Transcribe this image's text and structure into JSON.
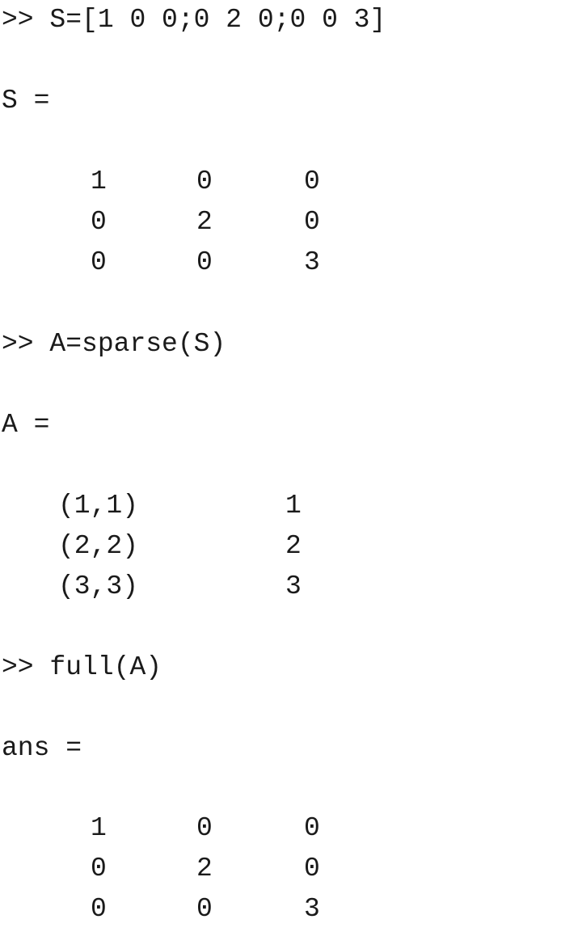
{
  "commands": [
    {
      "prompt": ">>",
      "input": "S=[1 0 0;0 2 0;0 0 3]",
      "output_var": "S =",
      "matrix": [
        [
          "1",
          "0",
          "0"
        ],
        [
          "0",
          "2",
          "0"
        ],
        [
          "0",
          "0",
          "3"
        ]
      ]
    },
    {
      "prompt": ">>",
      "input": "A=sparse(S)",
      "output_var": "A =",
      "sparse_entries": [
        {
          "index": "(1,1)",
          "value": "1"
        },
        {
          "index": "(2,2)",
          "value": "2"
        },
        {
          "index": "(3,3)",
          "value": "3"
        }
      ]
    },
    {
      "prompt": ">>",
      "input": "full(A)",
      "output_var": "ans =",
      "matrix": [
        [
          "1",
          "0",
          "0"
        ],
        [
          "0",
          "2",
          "0"
        ],
        [
          "0",
          "0",
          "3"
        ]
      ]
    }
  ]
}
